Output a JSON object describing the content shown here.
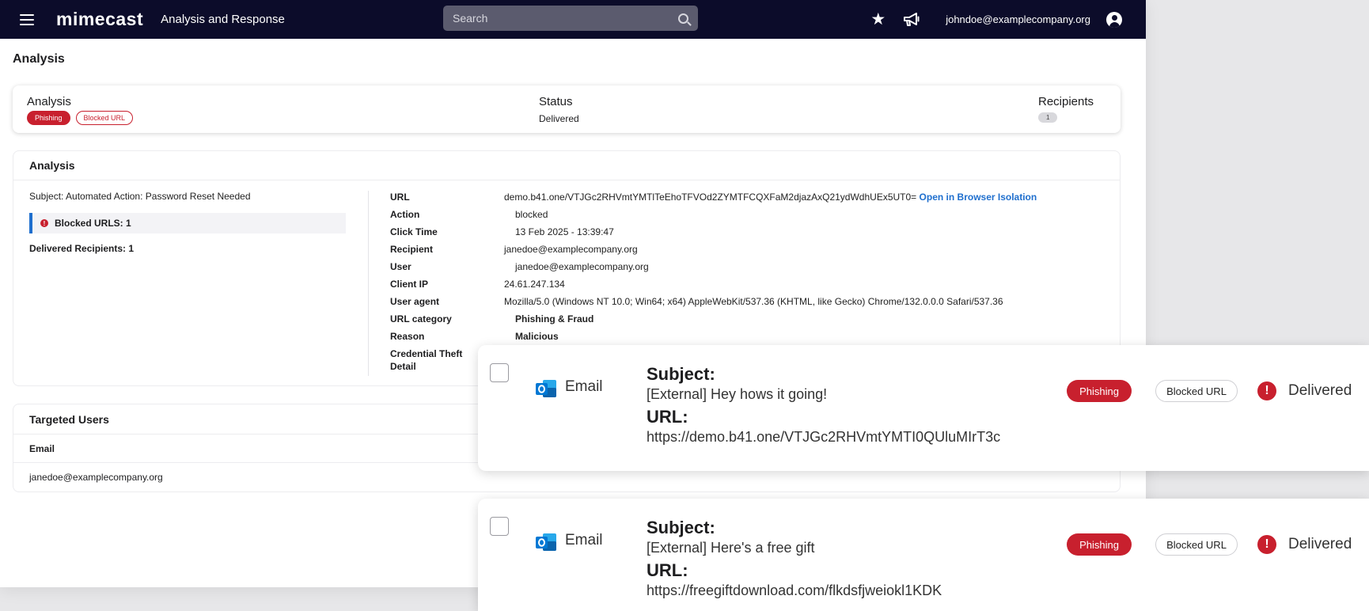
{
  "topbar": {
    "brand": "mimecast",
    "app_title": "Analysis and Response",
    "search_placeholder": "Search",
    "user_email": "johndoe@examplecompany.org"
  },
  "page_title": "Analysis",
  "summary": {
    "analysis_label": "Analysis",
    "tags": [
      "Phishing",
      "Blocked URL"
    ],
    "status_label": "Status",
    "status_value": "Delivered",
    "recipients_label": "Recipients",
    "recipients_count": "1"
  },
  "analysis": {
    "header": "Analysis",
    "subject": "Subject: Automated Action: Password Reset Needed",
    "blocked_urls": "Blocked URLS: 1",
    "delivered_recipients": "Delivered Recipients: 1",
    "details": {
      "url_label": "URL",
      "url_value": "demo.b41.one/VTJGc2RHVmtYMTlTeEhoTFVOd2ZYMTFCQXFaM2djazAxQ21ydWdhUEx5UT0=",
      "url_link": "Open in Browser Isolation",
      "action_label": "Action",
      "action_value": "blocked",
      "click_time_label": "Click Time",
      "click_time_value": "13 Feb 2025 - 13:39:47",
      "recipient_label": "Recipient",
      "recipient_value": "janedoe@examplecompany.org",
      "user_label": "User",
      "user_value": "janedoe@examplecompany.org",
      "client_ip_label": "Client IP",
      "client_ip_value": "24.61.247.134",
      "user_agent_label": "User agent",
      "user_agent_value": "Mozilla/5.0 (Windows NT 10.0; Win64; x64) AppleWebKit/537.36 (KHTML, like Gecko) Chrome/132.0.0.0 Safari/537.36",
      "url_category_label": "URL category",
      "url_category_value": "Phishing & Fraud",
      "reason_label": "Reason",
      "reason_value": "Malicious",
      "credential_label_1": "Credential Theft",
      "credential_label_2": "Detail"
    }
  },
  "targeted_users": {
    "header": "Targeted Users",
    "column_email": "Email",
    "rows": [
      "janedoe@examplecompany.org"
    ]
  },
  "emails": [
    {
      "type": "Email",
      "subject_label": "Subject:",
      "subject": "[External] Hey hows it going!",
      "url_label": "URL:",
      "url": "https://demo.b41.one/VTJGc2RHVmtYMTI0QUluMIrT3c",
      "tag1": "Phishing",
      "tag2": "Blocked URL",
      "status": "Delivered"
    },
    {
      "type": "Email",
      "subject_label": "Subject:",
      "subject": "[External] Here's a free gift",
      "url_label": "URL:",
      "url": "https://freegiftdownload.com/flkdsfjweiokl1KDK",
      "tag1": "Phishing",
      "tag2": "Blocked URL",
      "status": "Delivered"
    }
  ],
  "colors": {
    "navbar": "#0c0c2a",
    "danger": "#c8202e",
    "link": "#1f6fce"
  }
}
